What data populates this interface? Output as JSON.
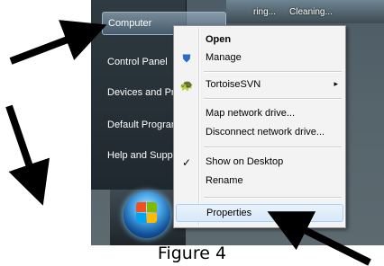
{
  "start_menu": {
    "items": [
      {
        "label": "Computer"
      },
      {
        "label": "Control Panel"
      },
      {
        "label": "Devices and Printers"
      },
      {
        "label": "Default Programs"
      },
      {
        "label": "Help and Support"
      }
    ]
  },
  "taskbar_top": {
    "item1": "ring...",
    "item2": "Cleaning..."
  },
  "context_menu": {
    "items": [
      {
        "label": "Open",
        "bold": true,
        "icon": ""
      },
      {
        "label": "Manage",
        "icon": "shield-icon"
      },
      {
        "label": "TortoiseSVN",
        "icon": "tortoisesvn-icon",
        "submenu": "▸"
      },
      {
        "label": "Map network drive..."
      },
      {
        "label": "Disconnect network drive..."
      },
      {
        "label": "Show on Desktop",
        "icon": "checkmark-icon"
      },
      {
        "label": "Rename"
      },
      {
        "label": "Properties"
      }
    ],
    "hovered": "Properties"
  },
  "caption": "Figure 4",
  "colors": {
    "arrow": "#000000",
    "menu_bg": "#f3f3f3",
    "start_pane": "#2f3a41",
    "highlight_border": "#a8d1f5"
  }
}
